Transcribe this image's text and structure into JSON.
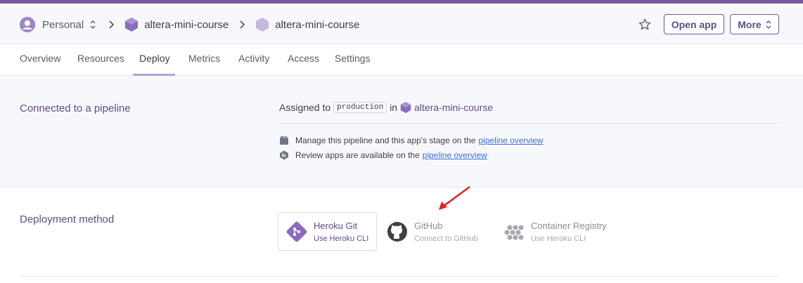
{
  "breadcrumb": {
    "account": "Personal",
    "pipeline": "altera-mini-course",
    "app": "altera-mini-course"
  },
  "actions": {
    "open_app": "Open app",
    "more": "More"
  },
  "tabs": [
    {
      "label": "Overview"
    },
    {
      "label": "Resources"
    },
    {
      "label": "Deploy",
      "active": true
    },
    {
      "label": "Metrics"
    },
    {
      "label": "Activity"
    },
    {
      "label": "Access"
    },
    {
      "label": "Settings"
    }
  ],
  "pipeline_section": {
    "label": "Connected to a pipeline",
    "assigned_prefix": "Assigned to",
    "stage": "production",
    "in_text": "in",
    "pipeline_name": "altera-mini-course",
    "notes": [
      {
        "icon": "pipeline-icon",
        "text": "Manage this pipeline and this app's stage on the",
        "link": "pipeline overview"
      },
      {
        "icon": "review-apps-icon",
        "text": "Review apps are available on the",
        "link": "pipeline overview"
      }
    ]
  },
  "deployment_section": {
    "label": "Deployment method",
    "methods": [
      {
        "icon": "heroku-git-icon",
        "title": "Heroku Git",
        "subtitle": "Use Heroku CLI",
        "selected": true
      },
      {
        "icon": "github-icon",
        "title": "GitHub",
        "subtitle": "Connect to GitHub",
        "selected": false
      },
      {
        "icon": "container-registry-icon",
        "title": "Container Registry",
        "subtitle": "Use Heroku CLI",
        "selected": false
      }
    ]
  },
  "colors": {
    "brand": "#79589f",
    "link": "#3a6fd8",
    "annotation_arrow": "#e02020"
  }
}
